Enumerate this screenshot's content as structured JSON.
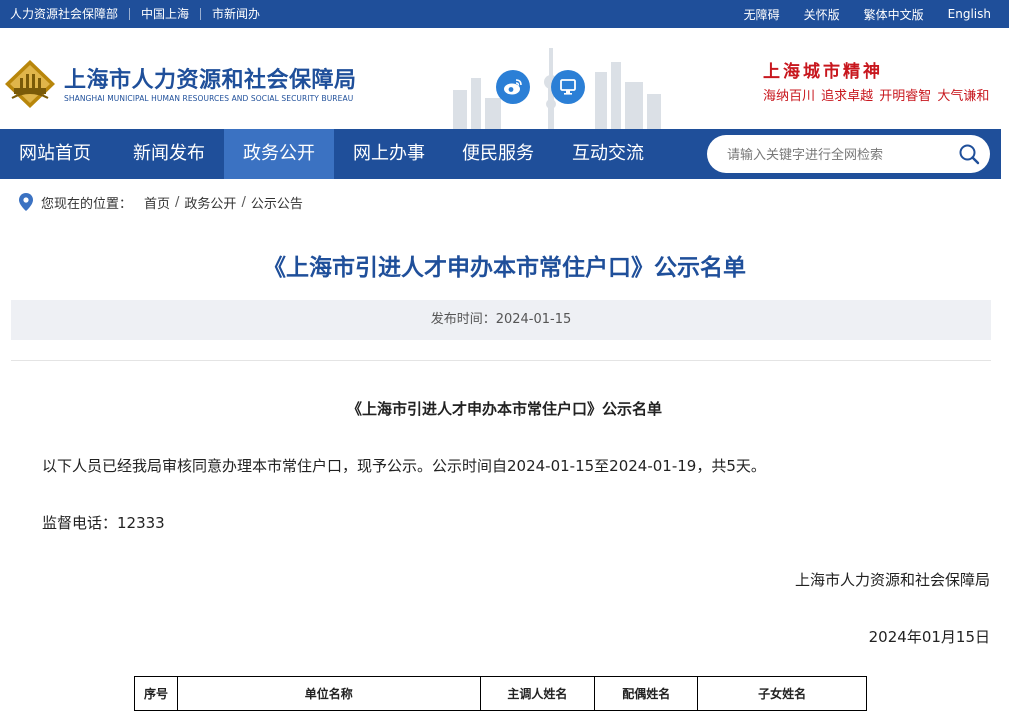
{
  "topbar": {
    "links_left": [
      "人力资源社会保障部",
      "中国上海",
      "市新闻办"
    ],
    "links_right": [
      "无障碍",
      "关怀版",
      "繁体中文版",
      "English"
    ]
  },
  "header": {
    "org_name": "上海市人力资源和社会保障局",
    "org_name_en": "SHANGHAI MUNICIPAL HUMAN RESOURCES AND SOCIAL SECURITY BUREAU",
    "social_icons": [
      "weibo-icon",
      "computer-icon"
    ],
    "spirit_title": "上海城市精神",
    "spirit_slogan": "海纳百川 追求卓越 开明睿智 大气谦和"
  },
  "nav": {
    "items": [
      "网站首页",
      "新闻发布",
      "政务公开",
      "网上办事",
      "便民服务",
      "互动交流"
    ],
    "active": "政务公开",
    "search_placeholder": "请输入关键字进行全网检索"
  },
  "breadcrumb": {
    "lead": "您现在的位置：",
    "items": [
      "首页",
      "政务公开",
      "公示公告"
    ],
    "separator": "/"
  },
  "article": {
    "title": "《上海市引进人才申办本市常住户口》公示名单",
    "publish_time": "发布时间：2024-01-15",
    "sub_title": "《上海市引进人才申办本市常住户口》公示名单",
    "body": "以下人员已经我局审核同意办理本市常住户口，现予公示。公示时间自2024-01-15至2024-01-19，共5天。",
    "hotline": "监督电话：12333",
    "signature_org": "上海市人力资源和社会保障局",
    "signature_date": "2024年01月15日"
  },
  "table": {
    "headers": [
      "序号",
      "单位名称",
      "主调人姓名",
      "配偶姓名",
      "子女姓名"
    ]
  },
  "colors": {
    "brand_blue": "#1f4f9a",
    "nav_active": "#3b72c2",
    "spirit_red": "#c8171e",
    "social_blue": "#2b7fd6"
  }
}
